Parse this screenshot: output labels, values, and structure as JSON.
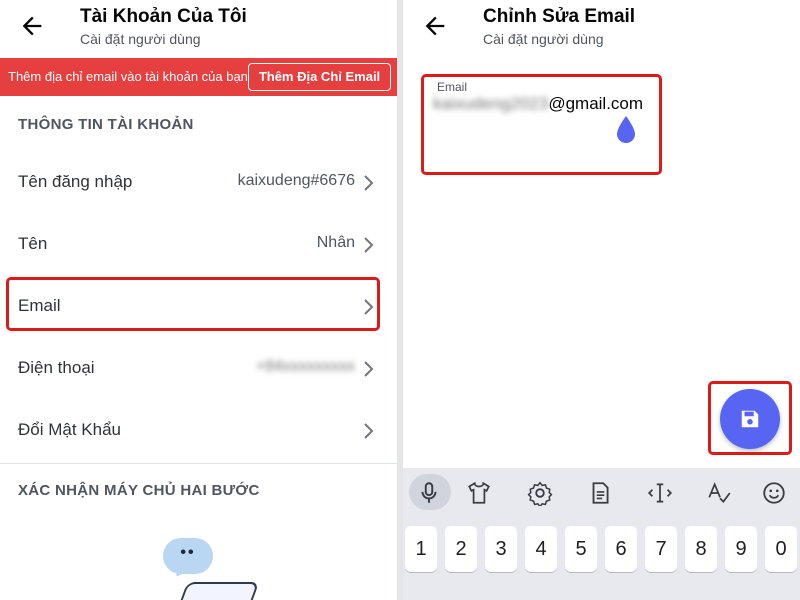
{
  "left": {
    "header": {
      "title": "Tài Khoản Của Tôi",
      "subtitle": "Cài đặt người dùng",
      "back_icon": "arrow-left-icon"
    },
    "banner": {
      "text": "Thêm địa chỉ email vào tài khoản của bạn",
      "button_label": "Thêm Địa Chỉ Email",
      "color": "#e53f3f"
    },
    "section_account": "THÔNG TIN TÀI KHOẢN",
    "rows": [
      {
        "label": "Tên đăng nhập",
        "value": "kaixudeng#6676"
      },
      {
        "label": "Tên",
        "value": "Nhân"
      },
      {
        "label": "Email",
        "value": ""
      },
      {
        "label": "Điện thoại",
        "value": "+84xxxxxxxxx"
      },
      {
        "label": "Đổi Mật Khẩu",
        "value": ""
      }
    ],
    "section_2fa": "XÁC NHẬN MÁY CHỦ HAI BƯỚC",
    "bubble_text": "••"
  },
  "right": {
    "header": {
      "title": "Chỉnh Sửa Email",
      "subtitle": "Cài đặt người dùng",
      "back_icon": "arrow-left-icon"
    },
    "email_label": "Email",
    "email_local": "kaixudeng2023",
    "email_domain": "@gmail.com",
    "fab_icon": "save-icon",
    "fab_color": "#5865f2",
    "keyboard": {
      "tools": [
        "mic-icon",
        "shirt-icon",
        "gear-icon",
        "clipboard-icon",
        "text-cursor-icon",
        "spellcheck-icon",
        "emoji-icon"
      ],
      "keys": [
        "1",
        "2",
        "3",
        "4",
        "5",
        "6",
        "7",
        "8",
        "9",
        "0"
      ]
    }
  },
  "highlight_color": "#dd1a1a"
}
